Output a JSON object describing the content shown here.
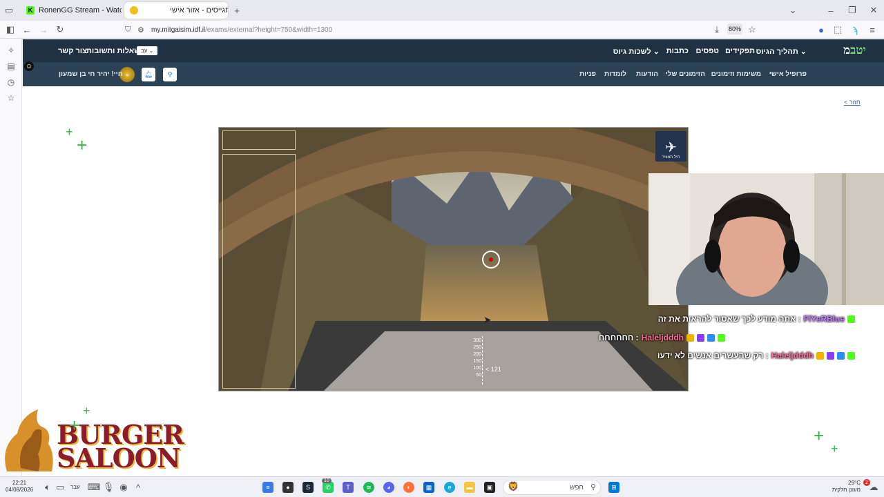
{
  "browser": {
    "tabs": [
      {
        "title": "RonenGG Stream - Watch Live o",
        "close": "✕"
      },
      {
        "title": "מתגייסים - אזור אישי",
        "close": "✕"
      }
    ],
    "new_tab": "+",
    "url_domain": "my.mitgaisim.idf.il",
    "url_path": "/exams/external?height=750&width=1300",
    "zoom": "80%"
  },
  "site": {
    "logo_main": "מ",
    "logo_accent": "יטב",
    "nav_top": [
      "תהליך הגיוס ⌄",
      "תפקידים",
      "טפסים",
      "כתבות",
      "לשכות גיוס ⌄"
    ],
    "help_links": [
      "שאלות ותשובות",
      "צור קשר"
    ],
    "lang": "עב ⌄",
    "nav_second": [
      "פרופיל אישי",
      "משימות וזימונים",
      "הזימונים שלי",
      "הודעות",
      "לומדות",
      "פניות"
    ],
    "greeting": "היי! יהיר חי בן שמעון ⌄",
    "back_link": "< חזור"
  },
  "game": {
    "altitude_scale": [
      "300",
      "250",
      "200",
      "150",
      "100",
      "50"
    ],
    "speed": "121",
    "emblem_text": "חיל האוויר"
  },
  "chat": [
    {
      "user": "FlYeRBlue",
      "message": "אתה מודע לכך שאסור להראות את זה :"
    },
    {
      "user": "Haleljdddh",
      "message": "חחחחחח :"
    },
    {
      "user": "Haleljdddh",
      "message": "רק שהעשרים אנשים לא ידעו :"
    }
  ],
  "overlay": {
    "line1": "BURGER",
    "line2": "SALOON"
  },
  "taskbar": {
    "time": "22:21",
    "date": "04/08/2026",
    "lang": "עבר",
    "search": "חפש",
    "badge": "10",
    "weather_temp": "29°C",
    "weather_desc": "מעונן חלקית",
    "notif": "2"
  },
  "colors": {
    "nav_dark": "#1f3143",
    "nav_mid": "#2b4256",
    "kick_green": "#53fc18",
    "accent_green": "#3cb34a"
  }
}
